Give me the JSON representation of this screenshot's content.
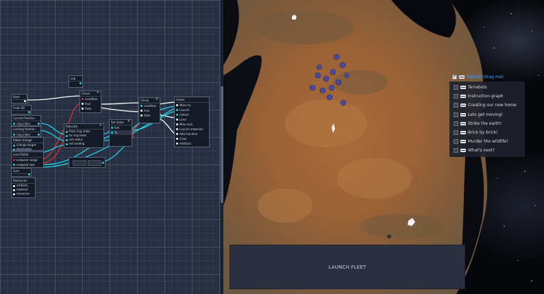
{
  "editor": {
    "nodes": [
      {
        "title": "Log",
        "ports": [
          ""
        ]
      },
      {
        "title": "Start",
        "ports": [
          ""
        ]
      },
      {
        "title": "Check",
        "ports": [
          "",
          "condition",
          "true",
          "false"
        ]
      },
      {
        "title": "Float 3D",
        "ports": [
          ""
        ]
      },
      {
        "title": "Current Position",
        "ports": [
          "",
          "ring index"
        ]
      },
      {
        "title": "Landing Position",
        "ports": [
          "",
          "ring index"
        ]
      },
      {
        "title": "Relocate",
        "ports": [
          "",
          "from ring index",
          "to ring index",
          "set radius",
          "set landing"
        ]
      },
      {
        "title": "Set Value",
        "ports": [
          "",
          "Get",
          "To"
        ]
      },
      {
        "title": "Check",
        "ports": [
          "",
          "condition",
          "true",
          "false"
        ]
      },
      {
        "title": "Action",
        "ports": [
          "",
          "Move to",
          "Launch",
          "Collect",
          "Land",
          "Mine rock",
          "Launch materials",
          "Add machine",
          "Crew",
          "Artifacts"
        ]
      },
      {
        "title": "Robot change",
        "ports": [
          "",
          "change target",
          "destination"
        ]
      },
      {
        "title": "Land Robot",
        "ports": [
          "",
          "endpoint range",
          "endpoint tool"
        ]
      },
      {
        "title": "Sum",
        "ports": [
          ""
        ]
      },
      {
        "title": "Resources",
        "ports": [
          "",
          "artifacts",
          "material",
          "resources"
        ]
      },
      {
        "title": "",
        "ports": [
          "Value"
        ]
      }
    ]
  },
  "game": {
    "launch_button": "LAUNCH FLEET",
    "tutorial": {
      "title": "Tutorial (drag me)",
      "checked": true,
      "items": [
        "Terrabots",
        "Instruction graph",
        "Creating our new home",
        "Lets get moving!",
        "Strike the earth!",
        "Brick by brick!",
        "Murder the wildlife!",
        "What's next?"
      ]
    }
  },
  "colors": {
    "editor_bg": "#263042",
    "wire_white": "#ffffff",
    "wire_cyan": "#22d3e6",
    "wire_red": "#e03030",
    "tutorial_title": "#4aa8ff",
    "launch_panel": "#2a3040"
  }
}
